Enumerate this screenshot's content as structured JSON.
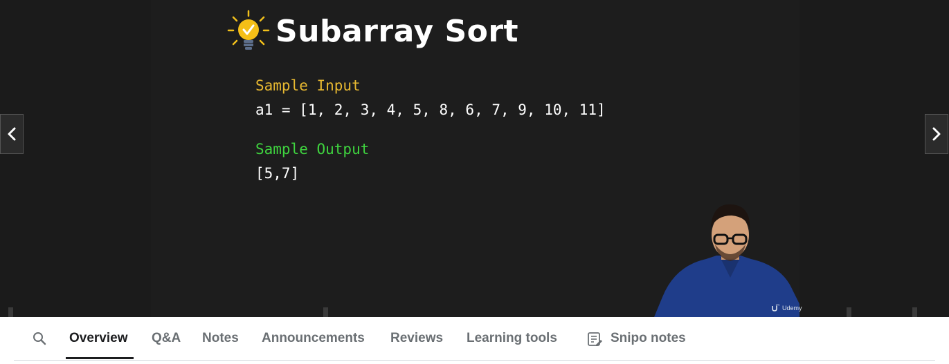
{
  "slide": {
    "title": "Subarray Sort",
    "sample_input_label": "Sample Input",
    "sample_input_value": "a1 = [1, 2, 3, 4, 5, 8, 6, 7, 9, 10, 11]",
    "sample_output_label": "Sample Output",
    "sample_output_value": "[5,7]",
    "colors": {
      "input_label": "#e8b931",
      "output_label": "#3fd43f",
      "background": "#1d1d1d"
    }
  },
  "video": {
    "prev_icon": "chevron-left-icon",
    "next_icon": "chevron-right-icon",
    "watermark": "Udemy"
  },
  "tabs": {
    "search_icon": "search-icon",
    "items": [
      {
        "label": "Overview",
        "active": true
      },
      {
        "label": "Q&A"
      },
      {
        "label": "Notes"
      },
      {
        "label": "Announcements"
      },
      {
        "label": "Reviews"
      },
      {
        "label": "Learning tools"
      },
      {
        "label": "Snipo notes",
        "icon": "notes-icon"
      }
    ]
  }
}
